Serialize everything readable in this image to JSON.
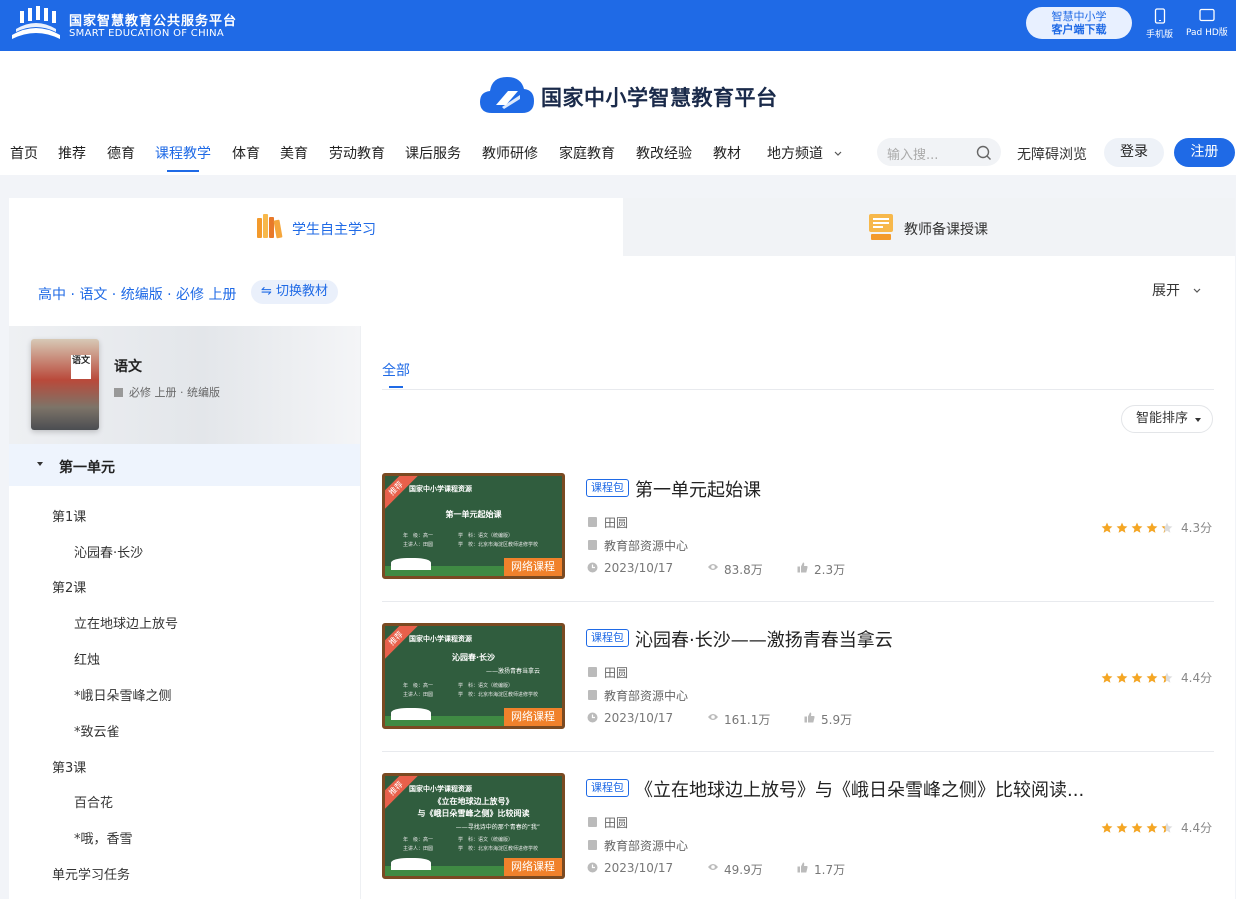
{
  "topbar": {
    "brand_cn": "国家智慧教育公共服务平台",
    "brand_en": "SMART EDUCATION OF CHINA",
    "download_line1": "智慧中小学",
    "download_line2": "客户端下载",
    "mobile_label": "手机版",
    "pad_label": "Pad HD版"
  },
  "header": {
    "site_title": "国家中小学智慧教育平台",
    "nav": [
      "首页",
      "推荐",
      "德育",
      "课程教学",
      "体育",
      "美育",
      "劳动教育",
      "课后服务",
      "教师研修",
      "家庭教育",
      "教改经验",
      "教材",
      "地方频道"
    ],
    "active_nav": "课程教学",
    "search_placeholder": "输入搜...",
    "accessible": "无障碍浏览",
    "login": "登录",
    "register": "注册"
  },
  "tabs": {
    "student": "学生自主学习",
    "teacher": "教师备课授课"
  },
  "crumb": "高中 · 语文 · 统编版 · 必修 上册",
  "switch_label": "⇋ 切换教材",
  "expand_label": "展开",
  "book": {
    "cover_text": "语文",
    "name": "语文",
    "meta": "必修 上册 · 统编版"
  },
  "toc": {
    "unit": "第一单元",
    "items": [
      "第1课",
      "沁园春·长沙",
      "第2课",
      "立在地球边上放号",
      "红烛",
      "*峨日朵雪峰之侧",
      "*致云雀",
      "第3课",
      "百合花",
      "*哦，香雪",
      "单元学习任务"
    ]
  },
  "filter": {
    "all": "全部",
    "sort": "智能排序"
  },
  "courses": [
    {
      "tag": "课程包",
      "title": "第一单元起始课",
      "teacher": "田圆",
      "org": "教育部资源中心",
      "date": "2023/10/17",
      "views": "83.8万",
      "likes": "2.3万",
      "rating": "4.3分",
      "stars": 4.3,
      "thumb_header": "国家中小学课程资源",
      "thumb_title": "第一单元起始课",
      "thumb_sub": "",
      "recommend": "推荐",
      "badge": "网络课程"
    },
    {
      "tag": "课程包",
      "title": "沁园春·长沙——激扬青春当拿云",
      "teacher": "田圆",
      "org": "教育部资源中心",
      "date": "2023/10/17",
      "views": "161.1万",
      "likes": "5.9万",
      "rating": "4.4分",
      "stars": 4.4,
      "thumb_header": "国家中小学课程资源",
      "thumb_title": "沁园春·长沙",
      "thumb_sub": "——激扬青春当拿云",
      "recommend": "推荐",
      "badge": "网络课程"
    },
    {
      "tag": "课程包",
      "title": "《立在地球边上放号》与《峨日朵雪峰之侧》比较阅读...",
      "teacher": "田圆",
      "org": "教育部资源中心",
      "date": "2023/10/17",
      "views": "49.9万",
      "likes": "1.7万",
      "rating": "4.4分",
      "stars": 4.4,
      "thumb_header": "国家中小学课程资源",
      "thumb_title": "《立在地球边上放号》\n与《峨日朵雪峰之侧》比较阅读",
      "thumb_sub": "——寻找诗中的那个青春的“我”",
      "recommend": "推荐",
      "badge": "网络课程"
    }
  ],
  "colors": {
    "brand_blue": "#1f6ae6",
    "star": "#f5a623",
    "badge_orange": "#f0812b",
    "recommend_red": "#e8604b"
  }
}
